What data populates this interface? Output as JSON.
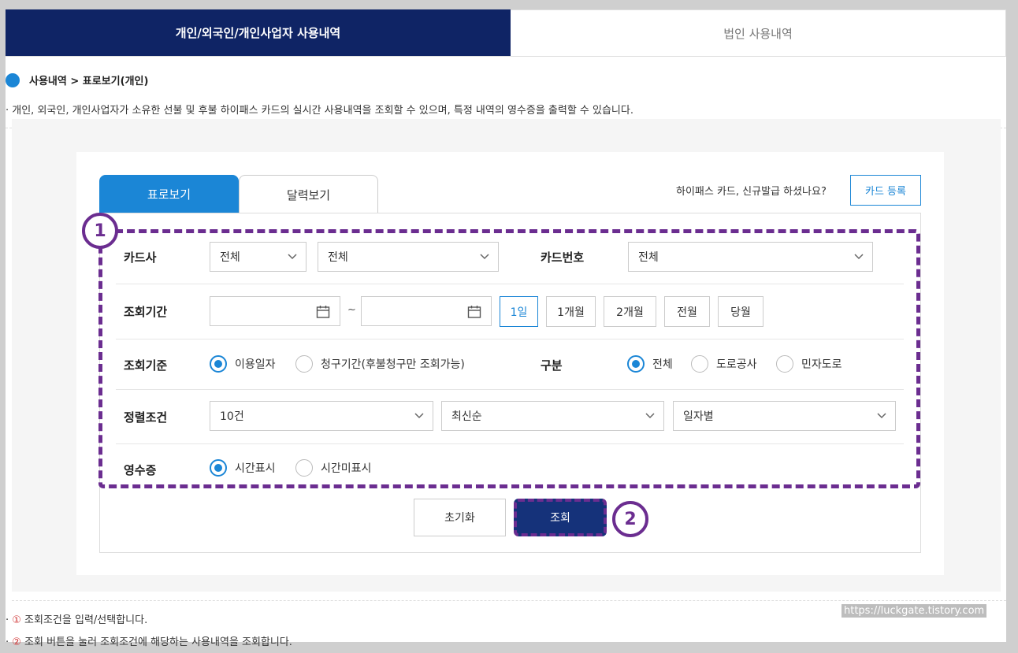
{
  "top_tabs": {
    "personal": "개인/외국인/개인사업자 사용내역",
    "corporate": "법인 사용내역"
  },
  "breadcrumb": "사용내역 > 표로보기(개인)",
  "description": "· 개인, 외국인, 개인사업자가 소유한 선불 및 후불 하이패스 카드의 실시간 사용내역을 조회할 수 있으며, 특정 내역의 영수증을 출력할 수 있습니다.",
  "sub_tabs": {
    "table": "표로보기",
    "calendar": "달력보기"
  },
  "new_card": {
    "text": "하이패스 카드, 신규발급 하셨나요?",
    "button": "카드 등록"
  },
  "form": {
    "card_company": {
      "label": "카드사",
      "select1": "전체",
      "select2": "전체"
    },
    "card_number": {
      "label": "카드번호",
      "value": "전체"
    },
    "period": {
      "label": "조회기간",
      "tilde": "~",
      "buttons": [
        "1일",
        "1개월",
        "2개월",
        "전월",
        "당월"
      ],
      "selected": "1일"
    },
    "criteria": {
      "label": "조회기준",
      "options": [
        "이용일자",
        "청구기간(후불청구만 조회가능)"
      ],
      "selected": "이용일자"
    },
    "division": {
      "label": "구분",
      "options": [
        "전체",
        "도로공사",
        "민자도로"
      ],
      "selected": "전체"
    },
    "sort": {
      "label": "정렬조건",
      "count": "10건",
      "order": "최신순",
      "group": "일자별"
    },
    "receipt": {
      "label": "영수증",
      "options": [
        "시간표시",
        "시간미표시"
      ],
      "selected": "시간표시"
    }
  },
  "buttons": {
    "reset": "초기화",
    "search": "조회"
  },
  "badges": {
    "one": "1",
    "two": "2"
  },
  "notes": [
    {
      "num": "①",
      "text": " 조회조건을 입력/선택합니다."
    },
    {
      "num": "②",
      "text": " 조회 버튼을 눌러 조회조건에 해당하는 사용내역을 조회합니다."
    }
  ],
  "watermark": "https://luckgate.tistory.com",
  "colors": {
    "navy": "#0f2465",
    "blue": "#1b86d6",
    "annotation": "#6b2d90",
    "note_number": "#d23b3b"
  }
}
